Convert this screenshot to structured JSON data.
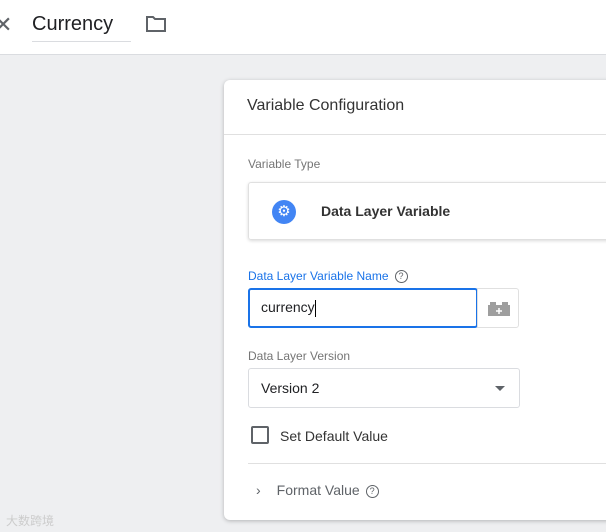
{
  "header": {
    "title": "Currency",
    "close_icon": "close-icon",
    "folder_icon": "folder-icon"
  },
  "card": {
    "title": "Variable Configuration",
    "variable_type_label": "Variable Type",
    "variable_type": "Data Layer Variable",
    "name_label": "Data Layer Variable Name",
    "name_value": "currency",
    "version_label": "Data Layer Version",
    "version_value": "Version 2",
    "default_value_label": "Set Default Value",
    "format_value_label": "Format Value"
  },
  "colors": {
    "accent": "#1a73e8",
    "icon_blue": "#4285f4"
  },
  "watermark": "大数跨境"
}
